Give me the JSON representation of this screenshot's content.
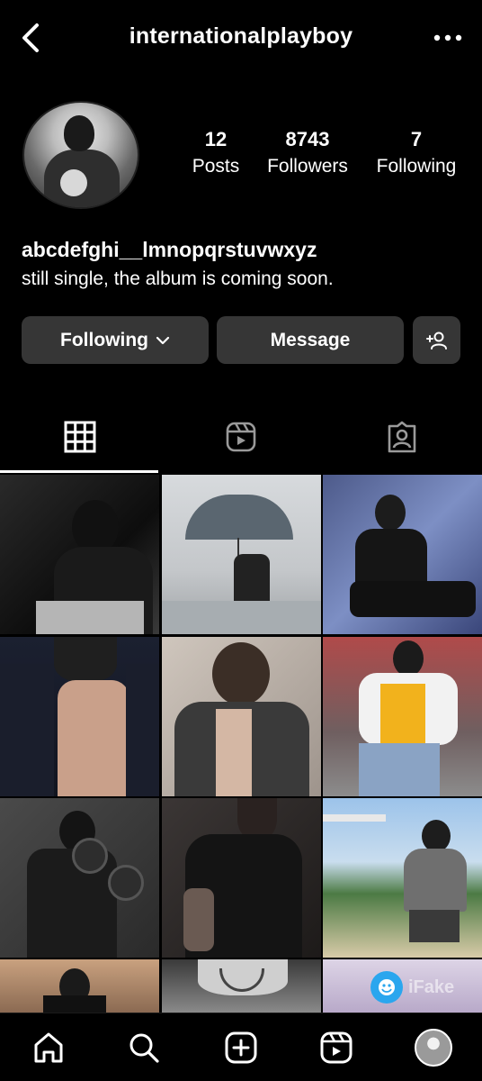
{
  "header": {
    "username": "internationalplayboy"
  },
  "profile": {
    "stats": [
      {
        "value": "12",
        "label": "Posts"
      },
      {
        "value": "8743",
        "label": "Followers"
      },
      {
        "value": "7",
        "label": "Following"
      }
    ],
    "display_name": "abcdefghi__lmnopqrstuvwxyz",
    "bio": "still single, the album is coming soon."
  },
  "actions": {
    "following_label": "Following",
    "message_label": "Message"
  },
  "tabs": [
    {
      "icon": "grid-icon",
      "active": true
    },
    {
      "icon": "reels-icon",
      "active": false
    },
    {
      "icon": "tagged-icon",
      "active": false
    }
  ],
  "watermark": {
    "text": "iFake"
  },
  "nav": [
    "home-icon",
    "search-icon",
    "create-icon",
    "reels-icon",
    "profile-avatar"
  ],
  "colors": {
    "background": "#000000",
    "button": "#363636",
    "text": "#ffffff"
  }
}
